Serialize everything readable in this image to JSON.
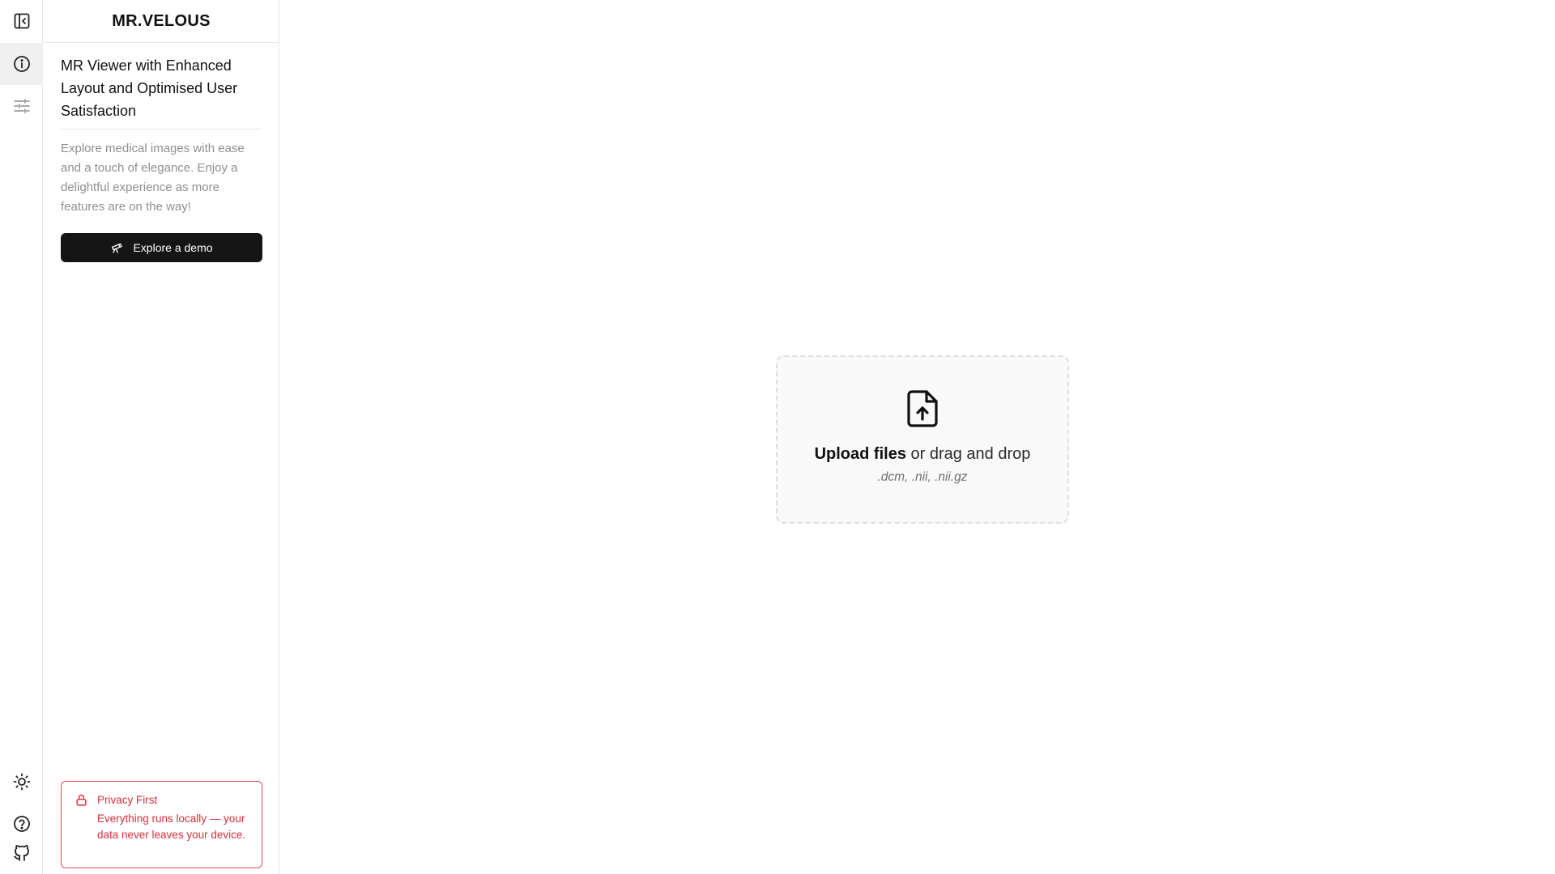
{
  "app": {
    "brand": "MR.VELOUS"
  },
  "rail": {
    "top_items": [
      {
        "icon": "sidebar-collapse-icon"
      },
      {
        "icon": "info-icon",
        "active": true
      },
      {
        "icon": "sliders-icon"
      }
    ],
    "bottom_items": [
      {
        "icon": "sun-icon"
      },
      {
        "icon": "help-icon"
      },
      {
        "icon": "github-icon"
      }
    ]
  },
  "panel": {
    "title": "MR Viewer with Enhanced Layout and Optimised User Satisfaction",
    "description": "Explore medical images with ease and a touch of elegance. Enjoy a delightful experience as more features are on the way!",
    "demo_button": {
      "label": "Explore a demo",
      "icon": "telescope-icon"
    },
    "privacy": {
      "icon": "lock-icon",
      "title": "Privacy First",
      "text": "Everything runs locally — your data never leaves your device."
    }
  },
  "dropzone": {
    "icon": "file-upload-icon",
    "upload_label": "Upload files",
    "drag_text": " or drag and drop",
    "formats": ".dcm, .nii, .nii.gz"
  },
  "colors": {
    "accent_dark": "#151515",
    "privacy_red": "#d92d3a",
    "border": "#e6e6e6",
    "dropzone_bg": "#f9f9f9"
  }
}
